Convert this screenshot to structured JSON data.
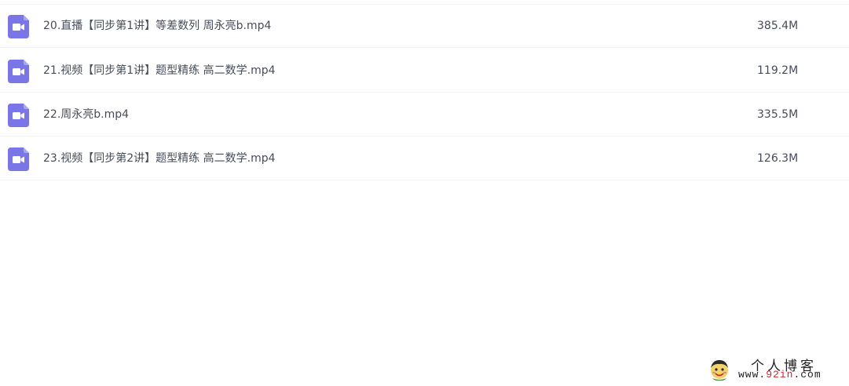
{
  "files": [
    {
      "name": "20.直播【同步第1讲】等差数列 周永亮b.mp4",
      "size": "385.4M",
      "icon": "video-file-icon"
    },
    {
      "name": "21.视频【同步第1讲】题型精练 高二数学.mp4",
      "size": "119.2M",
      "icon": "video-file-icon"
    },
    {
      "name": "22.周永亮b.mp4",
      "size": "335.5M",
      "icon": "video-file-icon"
    },
    {
      "name": "23.视频【同步第2讲】题型精练 高二数学.mp4",
      "size": "126.3M",
      "icon": "video-file-icon"
    }
  ],
  "watermark": {
    "title": "个人博客",
    "url_prefix": "www.",
    "url_accent": "92in",
    "url_suffix": ".com"
  },
  "colors": {
    "icon": "#7b76e8",
    "text": "#454d5a",
    "divider": "#f1f2f4",
    "watermark_accent": "#d0252c"
  }
}
